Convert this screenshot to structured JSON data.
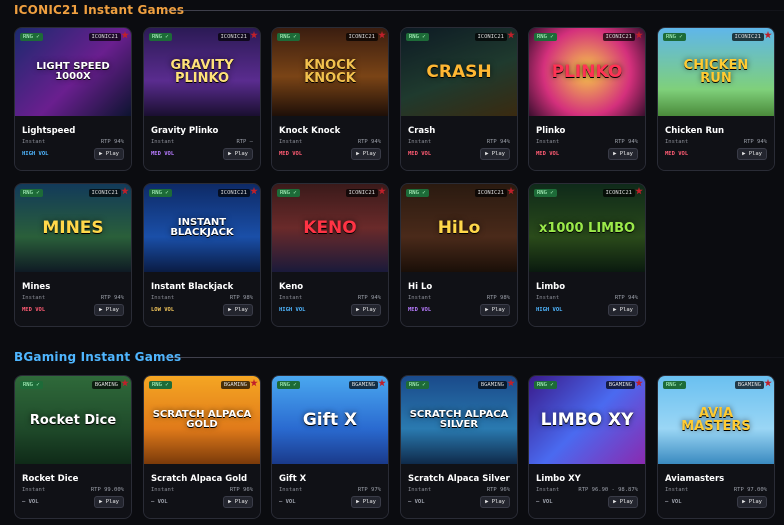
{
  "sections": [
    {
      "title": "ICONIC21 Instant Games",
      "title_color": "#f0a040",
      "games": [
        {
          "name": "Lightspeed",
          "type": "Instant",
          "rtp": "RTP 94%",
          "vol": "HIGH VOL",
          "vol_class": "vol-high",
          "play": "▶ Play",
          "rng": "RNG ✓",
          "provider": "ICONIC21",
          "art": "LIGHT SPEED 1000X",
          "art_color": "#ffffff",
          "bg": "linear-gradient(135deg,#1b2a6e,#6a1f8f 55%,#0d1430)"
        },
        {
          "name": "Gravity Plinko",
          "type": "Instant",
          "rtp": "RTP —",
          "vol": "MED VOL",
          "vol_class": "vol-med-purple",
          "play": "▶ Play",
          "rng": "RNG ✓",
          "provider": "ICONIC21",
          "art": "GRAVITY PLINKO",
          "art_color": "#ffe27a",
          "bg": "linear-gradient(180deg,#2b1a55,#5a2c8f 60%,#1a0f30)"
        },
        {
          "name": "Knock Knock",
          "type": "Instant",
          "rtp": "RTP 94%",
          "vol": "MED VOL",
          "vol_class": "vol-med",
          "play": "▶ Play",
          "rng": "RNG ✓",
          "provider": "ICONIC21",
          "art": "KNOCK KNOCK",
          "art_color": "#f2c14e",
          "bg": "linear-gradient(180deg,#3a1d10,#7a4416 55%,#1e0f08)"
        },
        {
          "name": "Crash",
          "type": "Instant",
          "rtp": "RTP 94%",
          "vol": "MED VOL",
          "vol_class": "vol-med",
          "play": "▶ Play",
          "rng": "RNG ✓",
          "provider": "ICONIC21",
          "art": "CRASH",
          "art_color": "#ffb733",
          "bg": "linear-gradient(160deg,#0d1a24,#1f3a2e 55%,#3a2a10)"
        },
        {
          "name": "Plinko",
          "type": "Instant",
          "rtp": "RTP 94%",
          "vol": "MED VOL",
          "vol_class": "vol-med",
          "play": "▶ Play",
          "rng": "RNG ✓",
          "provider": "ICONIC21",
          "art": "PLINKO",
          "art_color": "#ff3355",
          "bg": "radial-gradient(circle,#f7c948,#d4307c 60%,#3a0f2e)"
        },
        {
          "name": "Chicken Run",
          "type": "Instant",
          "rtp": "RTP 94%",
          "vol": "MED VOL",
          "vol_class": "vol-med",
          "play": "▶ Play",
          "rng": "RNG ✓",
          "provider": "ICONIC21",
          "art": "CHICKEN RUN",
          "art_color": "#ffcc33",
          "bg": "linear-gradient(180deg,#5fb6ea,#7fd07a 70%,#4a8a3a)"
        }
      ]
    },
    {
      "title": "",
      "title_color": "#f0a040",
      "games": [
        {
          "name": "Mines",
          "type": "Instant",
          "rtp": "RTP 94%",
          "vol": "MED VOL",
          "vol_class": "vol-med",
          "play": "▶ Play",
          "rng": "RNG ✓",
          "provider": "ICONIC21",
          "art": "MINES",
          "art_color": "#ffd84a",
          "bg": "linear-gradient(180deg,#123a5a,#2a5f3a 60%,#0f1a24)"
        },
        {
          "name": "Instant Blackjack",
          "type": "Instant",
          "rtp": "RTP 98%",
          "vol": "LOW VOL",
          "vol_class": "vol-low",
          "play": "▶ Play",
          "rng": "RNG ✓",
          "provider": "ICONIC21",
          "art": "INSTANT BLACKJACK",
          "art_color": "#ffffff",
          "bg": "linear-gradient(180deg,#0e2a66,#1a4fa8 60%,#0a1c44)"
        },
        {
          "name": "Keno",
          "type": "Instant",
          "rtp": "RTP 94%",
          "vol": "HIGH VOL",
          "vol_class": "vol-high",
          "play": "▶ Play",
          "rng": "RNG ✓",
          "provider": "ICONIC21",
          "art": "KENO",
          "art_color": "#ff3344",
          "bg": "linear-gradient(180deg,#3a1a1a,#6a2a2a 50%,#1a1a3a)"
        },
        {
          "name": "Hi Lo",
          "type": "Instant",
          "rtp": "RTP 98%",
          "vol": "MED VOL",
          "vol_class": "vol-med-purple",
          "play": "▶ Play",
          "rng": "RNG ✓",
          "provider": "ICONIC21",
          "art": "HiLo",
          "art_color": "#ffd84a",
          "bg": "linear-gradient(180deg,#2a1a10,#4a2a1a 60%,#1a0f08)"
        },
        {
          "name": "Limbo",
          "type": "Instant",
          "rtp": "RTP 94%",
          "vol": "HIGH VOL",
          "vol_class": "vol-high",
          "play": "▶ Play",
          "rng": "RNG ✓",
          "provider": "ICONIC21",
          "art": "x1000 LIMBO",
          "art_color": "#9bea4a",
          "bg": "linear-gradient(180deg,#0f2a1a,#2a4a1a 60%,#0a1a0f)"
        }
      ]
    },
    {
      "title": "BGaming Instant Games",
      "title_color": "#4fb6ff",
      "games": [
        {
          "name": "Rocket Dice",
          "type": "Instant",
          "rtp": "RTP 99.00%",
          "vol": "— VOL",
          "vol_class": "vol-dash",
          "play": "▶ Play",
          "rng": "RNG ✓",
          "provider": "BGAMING",
          "art": "Rocket Dice",
          "art_color": "#ffffff",
          "bg": "linear-gradient(180deg,#2f6a3a,#1f4a2a 60%,#0f2a18)"
        },
        {
          "name": "Scratch Alpaca Gold",
          "type": "Instant",
          "rtp": "RTP 96%",
          "vol": "— VOL",
          "vol_class": "vol-dash",
          "play": "▶ Play",
          "rng": "RNG ✓",
          "provider": "BGAMING",
          "art": "SCRATCH ALPACA GOLD",
          "art_color": "#ffffff",
          "bg": "linear-gradient(180deg,#f5a623,#e07a1a 60%,#7a3a0a)"
        },
        {
          "name": "Gift X",
          "type": "Instant",
          "rtp": "RTP 97%",
          "vol": "— VOL",
          "vol_class": "vol-dash",
          "play": "▶ Play",
          "rng": "RNG ✓",
          "provider": "BGAMING",
          "art": "Gift X",
          "art_color": "#ffffff",
          "bg": "linear-gradient(180deg,#4aa8f0,#2a6ad0 60%,#1a3a8a)"
        },
        {
          "name": "Scratch Alpaca Silver",
          "type": "Instant",
          "rtp": "RTP 96%",
          "vol": "— VOL",
          "vol_class": "vol-dash",
          "play": "▶ Play",
          "rng": "RNG ✓",
          "provider": "BGAMING",
          "art": "SCRATCH ALPACA SILVER",
          "art_color": "#ffffff",
          "bg": "linear-gradient(180deg,#1a4a8a,#2a7ab0 60%,#0f2a4a)"
        },
        {
          "name": "Limbo XY",
          "type": "Instant",
          "rtp": "RTP 96.90 - 98.87%",
          "vol": "— VOL",
          "vol_class": "vol-dash",
          "play": "▶ Play",
          "rng": "RNG ✓",
          "provider": "BGAMING",
          "art": "LIMBO XY",
          "art_color": "#ffffff",
          "bg": "linear-gradient(135deg,#3a1a8a,#4a6af0 50%,#8a2ab0)"
        },
        {
          "name": "Aviamasters",
          "type": "Instant",
          "rtp": "RTP 97.00%",
          "vol": "— VOL",
          "vol_class": "vol-dash",
          "play": "▶ Play",
          "rng": "RNG ✓",
          "provider": "BGAMING",
          "art": "AVIA MASTERS",
          "art_color": "#ffcc33",
          "bg": "linear-gradient(180deg,#6ac0f0,#9ad6f5 60%,#3a8ac0)"
        }
      ]
    }
  ]
}
